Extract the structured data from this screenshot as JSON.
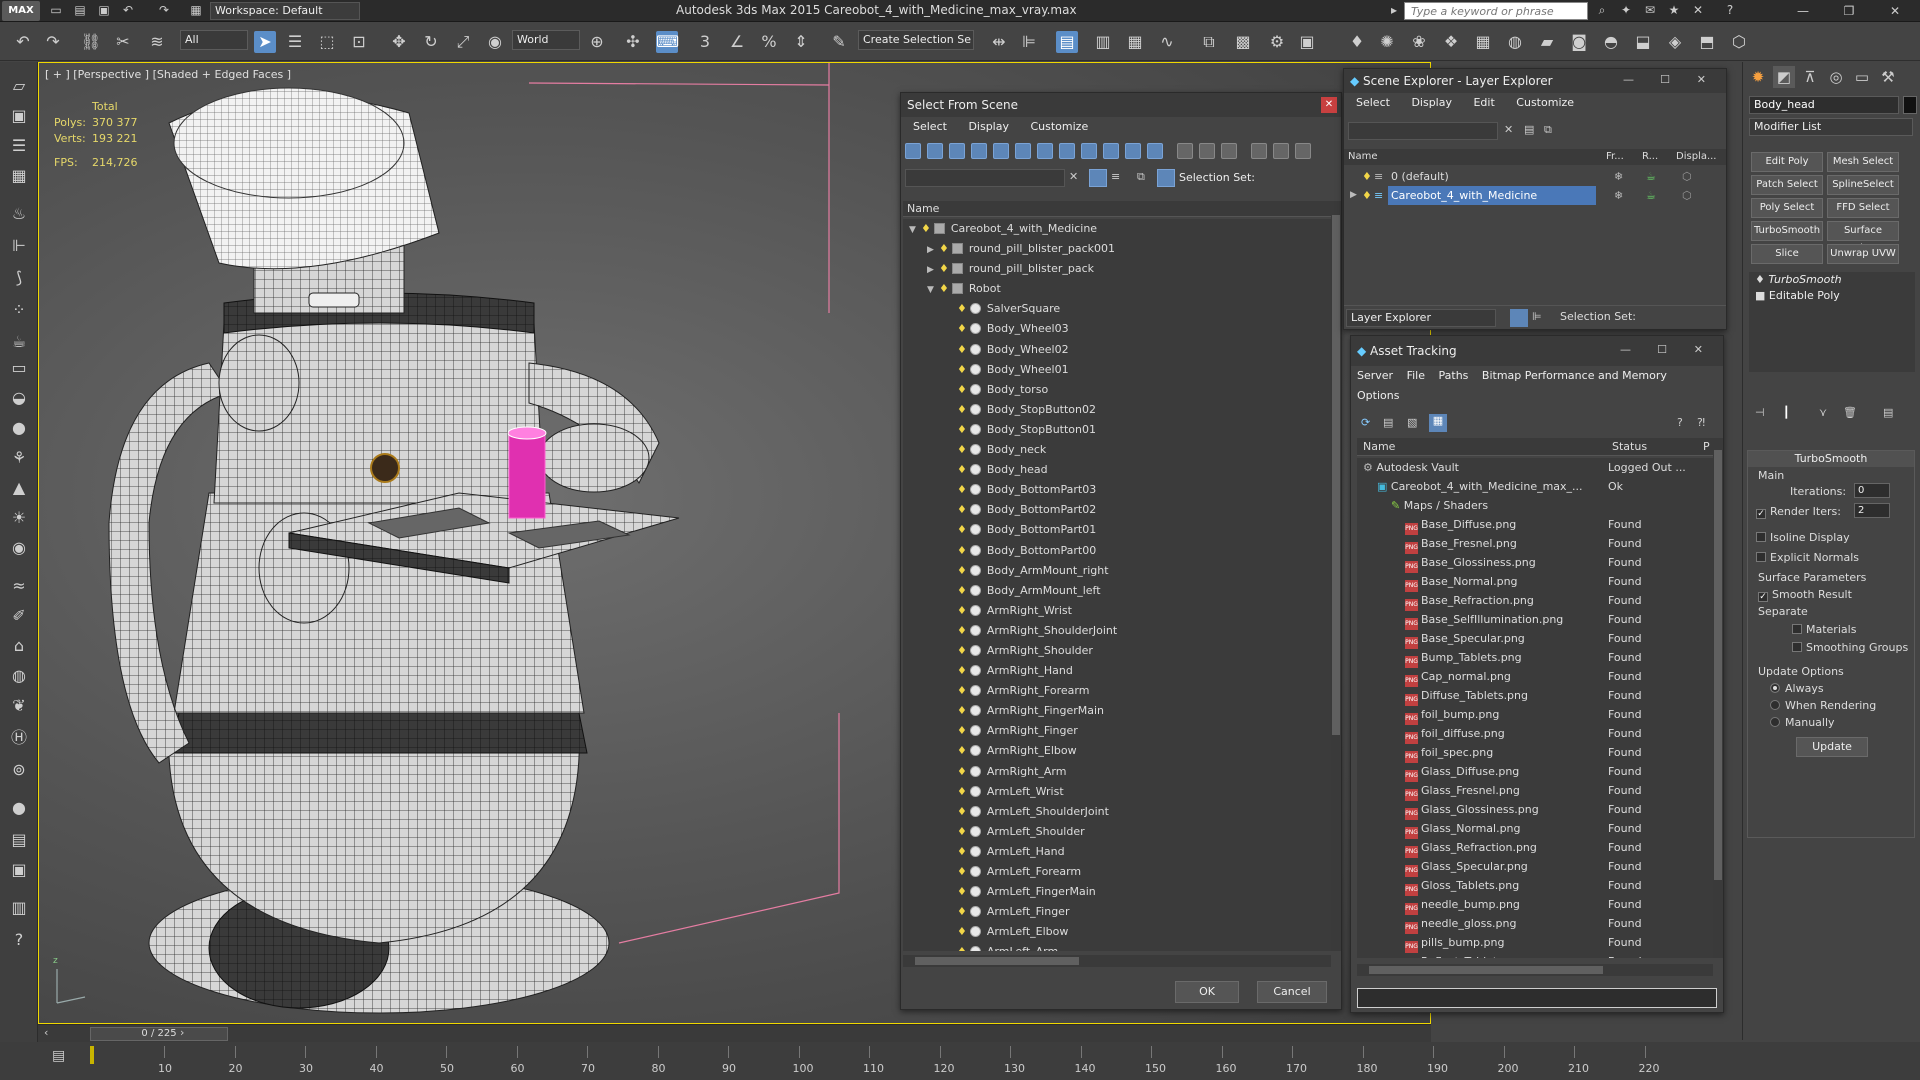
{
  "app": {
    "logo": "MAX",
    "workspace_label": "Workspace: Default",
    "title": "Autodesk 3ds Max  2015       Careobot_4_with_Medicine_max_vray.max",
    "search_placeholder": "Type a keyword or phrase"
  },
  "toolbar": {
    "selection_filter": "All",
    "ref_coord": "World",
    "snap_label": "3",
    "angle_snap": "n",
    "selection_set_placeholder": "Create Selection Se"
  },
  "viewport": {
    "label": "[ + ] [Perspective ] [Shaded + Edged Faces ]",
    "stats": {
      "total_label": "Total",
      "polys_label": "Polys:",
      "polys_value": "370 377",
      "verts_label": "Verts:",
      "verts_value": "193 221",
      "fps_label": "FPS:",
      "fps_value": "214,726"
    }
  },
  "select_from_scene": {
    "title": "Select From Scene",
    "menus": [
      "Select",
      "Display",
      "Customize"
    ],
    "selection_set_label": "Selection Set:",
    "column_name": "Name",
    "ok_label": "OK",
    "cancel_label": "Cancel",
    "tree": [
      {
        "label": "Careobot_4_with_Medicine",
        "level": 0,
        "expand": "open",
        "kind": "group"
      },
      {
        "label": "round_pill_blister_pack001",
        "level": 1,
        "expand": "closed",
        "kind": "group"
      },
      {
        "label": "round_pill_blister_pack",
        "level": 1,
        "expand": "closed",
        "kind": "group"
      },
      {
        "label": "Robot",
        "level": 1,
        "expand": "open",
        "kind": "group"
      },
      {
        "label": "SalverSquare",
        "level": 2,
        "kind": "obj"
      },
      {
        "label": "Body_Wheel03",
        "level": 2,
        "kind": "obj"
      },
      {
        "label": "Body_Wheel02",
        "level": 2,
        "kind": "obj"
      },
      {
        "label": "Body_Wheel01",
        "level": 2,
        "kind": "obj"
      },
      {
        "label": "Body_torso",
        "level": 2,
        "kind": "obj"
      },
      {
        "label": "Body_StopButton02",
        "level": 2,
        "kind": "obj"
      },
      {
        "label": "Body_StopButton01",
        "level": 2,
        "kind": "obj"
      },
      {
        "label": "Body_neck",
        "level": 2,
        "kind": "obj"
      },
      {
        "label": "Body_head",
        "level": 2,
        "kind": "obj"
      },
      {
        "label": "Body_BottomPart03",
        "level": 2,
        "kind": "obj"
      },
      {
        "label": "Body_BottomPart02",
        "level": 2,
        "kind": "obj"
      },
      {
        "label": "Body_BottomPart01",
        "level": 2,
        "kind": "obj"
      },
      {
        "label": "Body_BottomPart00",
        "level": 2,
        "kind": "obj"
      },
      {
        "label": "Body_ArmMount_right",
        "level": 2,
        "kind": "obj"
      },
      {
        "label": "Body_ArmMount_left",
        "level": 2,
        "kind": "obj"
      },
      {
        "label": "ArmRight_Wrist",
        "level": 2,
        "kind": "obj"
      },
      {
        "label": "ArmRight_ShoulderJoint",
        "level": 2,
        "kind": "obj"
      },
      {
        "label": "ArmRight_Shoulder",
        "level": 2,
        "kind": "obj"
      },
      {
        "label": "ArmRight_Hand",
        "level": 2,
        "kind": "obj"
      },
      {
        "label": "ArmRight_Forearm",
        "level": 2,
        "kind": "obj"
      },
      {
        "label": "ArmRight_FingerMain",
        "level": 2,
        "kind": "obj"
      },
      {
        "label": "ArmRight_Finger",
        "level": 2,
        "kind": "obj"
      },
      {
        "label": "ArmRight_Elbow",
        "level": 2,
        "kind": "obj"
      },
      {
        "label": "ArmRight_Arm",
        "level": 2,
        "kind": "obj"
      },
      {
        "label": "ArmLeft_Wrist",
        "level": 2,
        "kind": "obj"
      },
      {
        "label": "ArmLeft_ShoulderJoint",
        "level": 2,
        "kind": "obj"
      },
      {
        "label": "ArmLeft_Shoulder",
        "level": 2,
        "kind": "obj"
      },
      {
        "label": "ArmLeft_Hand",
        "level": 2,
        "kind": "obj"
      },
      {
        "label": "ArmLeft_Forearm",
        "level": 2,
        "kind": "obj"
      },
      {
        "label": "ArmLeft_FingerMain",
        "level": 2,
        "kind": "obj"
      },
      {
        "label": "ArmLeft_Finger",
        "level": 2,
        "kind": "obj"
      },
      {
        "label": "ArmLeft_Elbow",
        "level": 2,
        "kind": "obj"
      },
      {
        "label": "ArmLeft_Arm",
        "level": 2,
        "kind": "obj"
      }
    ]
  },
  "scene_explorer": {
    "title": "Scene Explorer - Layer Explorer",
    "menus": [
      "Select",
      "Display",
      "Edit",
      "Customize"
    ],
    "columns": [
      "Name",
      "Fr...",
      "R...",
      "Displa..."
    ],
    "layers": [
      {
        "label": "0 (default)",
        "selected": false
      },
      {
        "label": "Careobot_4_with_Medicine",
        "selected": true
      }
    ],
    "explorer_dropdown": "Layer Explorer",
    "selection_set_label": "Selection Set:"
  },
  "asset_tracking": {
    "title": "Asset Tracking",
    "menus": [
      "Server",
      "File",
      "Paths",
      "Bitmap Performance and Memory"
    ],
    "menu_second_line": "Options",
    "columns": [
      "Name",
      "Status",
      "P"
    ],
    "rows": [
      {
        "name": "Autodesk Vault",
        "status": "Logged Out ...",
        "level": 0,
        "icon": "vault"
      },
      {
        "name": "Careobot_4_with_Medicine_max_...",
        "status": "Ok",
        "level": 1,
        "icon": "max"
      },
      {
        "name": "Maps / Shaders",
        "status": "",
        "level": 2,
        "icon": "maps"
      },
      {
        "name": "Base_Diffuse.png",
        "status": "Found",
        "level": 3,
        "icon": "png"
      },
      {
        "name": "Base_Fresnel.png",
        "status": "Found",
        "level": 3,
        "icon": "png"
      },
      {
        "name": "Base_Glossiness.png",
        "status": "Found",
        "level": 3,
        "icon": "png"
      },
      {
        "name": "Base_Normal.png",
        "status": "Found",
        "level": 3,
        "icon": "png"
      },
      {
        "name": "Base_Refraction.png",
        "status": "Found",
        "level": 3,
        "icon": "png"
      },
      {
        "name": "Base_SelfIllumination.png",
        "status": "Found",
        "level": 3,
        "icon": "png"
      },
      {
        "name": "Base_Specular.png",
        "status": "Found",
        "level": 3,
        "icon": "png"
      },
      {
        "name": "Bump_Tablets.png",
        "status": "Found",
        "level": 3,
        "icon": "png"
      },
      {
        "name": "Cap_normal.png",
        "status": "Found",
        "level": 3,
        "icon": "png"
      },
      {
        "name": "Diffuse_Tablets.png",
        "status": "Found",
        "level": 3,
        "icon": "png"
      },
      {
        "name": "foil_bump.png",
        "status": "Found",
        "level": 3,
        "icon": "png"
      },
      {
        "name": "foil_diffuse.png",
        "status": "Found",
        "level": 3,
        "icon": "png"
      },
      {
        "name": "foil_spec.png",
        "status": "Found",
        "level": 3,
        "icon": "png"
      },
      {
        "name": "Glass_Diffuse.png",
        "status": "Found",
        "level": 3,
        "icon": "png"
      },
      {
        "name": "Glass_Fresnel.png",
        "status": "Found",
        "level": 3,
        "icon": "png"
      },
      {
        "name": "Glass_Glossiness.png",
        "status": "Found",
        "level": 3,
        "icon": "png"
      },
      {
        "name": "Glass_Normal.png",
        "status": "Found",
        "level": 3,
        "icon": "png"
      },
      {
        "name": "Glass_Refraction.png",
        "status": "Found",
        "level": 3,
        "icon": "png"
      },
      {
        "name": "Glass_Specular.png",
        "status": "Found",
        "level": 3,
        "icon": "png"
      },
      {
        "name": "Gloss_Tablets.png",
        "status": "Found",
        "level": 3,
        "icon": "png"
      },
      {
        "name": "needle_bump.png",
        "status": "Found",
        "level": 3,
        "icon": "png"
      },
      {
        "name": "needle_gloss.png",
        "status": "Found",
        "level": 3,
        "icon": "png"
      },
      {
        "name": "pills_bump.png",
        "status": "Found",
        "level": 3,
        "icon": "png"
      },
      {
        "name": "Reflect_Tablets.png",
        "status": "Found",
        "level": 3,
        "icon": "png"
      }
    ]
  },
  "command_panel": {
    "object_name": "Body_head",
    "modifier_list": "Modifier List",
    "buttons": [
      "Edit Poly",
      "Mesh Select",
      "Patch Select",
      "SplineSelect",
      "Poly Select",
      "FFD Select",
      "TurboSmooth",
      "Surface Select",
      "Slice",
      "Unwrap UVW"
    ],
    "stack": [
      "TurboSmooth",
      "Editable Poly"
    ],
    "turbosmooth": {
      "title": "TurboSmooth",
      "main_label": "Main",
      "iterations_label": "Iterations:",
      "iterations_value": "0",
      "render_iters_label": "Render Iters:",
      "render_iters_value": "2",
      "isoline_label": "Isoline Display",
      "explicit_normals_label": "Explicit Normals",
      "surface_params_label": "Surface Parameters",
      "smooth_result_label": "Smooth Result",
      "separate_label": "Separate",
      "materials_label": "Materials",
      "smoothing_groups_label": "Smoothing Groups",
      "update_options_label": "Update Options",
      "always_label": "Always",
      "when_rendering_label": "When Rendering",
      "manually_label": "Manually",
      "update_button": "Update"
    }
  },
  "timeline": {
    "frame_label": "0 / 225",
    "ticks": [
      "10",
      "20",
      "30",
      "40",
      "50",
      "60",
      "70",
      "80",
      "90",
      "100",
      "110",
      "120",
      "130",
      "140",
      "150",
      "160",
      "170",
      "180",
      "190",
      "200",
      "210",
      "220"
    ]
  }
}
